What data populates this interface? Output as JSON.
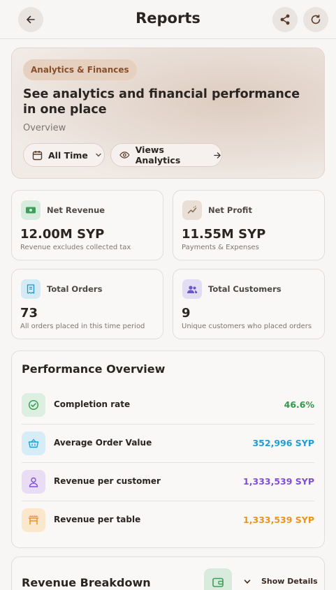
{
  "header": {
    "title": "Reports"
  },
  "hero": {
    "chip": "Analytics & Finances",
    "heading": "See analytics and financial performance in one place",
    "subtitle": "Overview",
    "filter_label": "All Time",
    "analytics_label": "Views Analytics"
  },
  "stats": [
    {
      "label": "Net Revenue",
      "value": "12.00M SYP",
      "note": "Revenue excludes collected tax",
      "icon": "banknote-icon",
      "color": "#3e9e5a"
    },
    {
      "label": "Net Profit",
      "value": "11.55M SYP",
      "note": "Payments & Expenses",
      "icon": "trend-icon",
      "color": "#8a6a4f"
    },
    {
      "label": "Total Orders",
      "value": "73",
      "note": "All orders placed in this time period",
      "icon": "receipt-icon",
      "color": "#2a93c2"
    },
    {
      "label": "Total Customers",
      "value": "9",
      "note": "Unique customers who placed orders",
      "icon": "users-icon",
      "color": "#6a55c9"
    }
  ],
  "performance": {
    "title": "Performance Overview",
    "rows": [
      {
        "label": "Completion rate",
        "value": "46.6%",
        "icon": "check-circle-icon",
        "color": "#2f9a4c"
      },
      {
        "label": "Average Order Value",
        "value": "352,996 SYP",
        "icon": "basket-icon",
        "color": "#1b9fd6"
      },
      {
        "label": "Revenue per customer",
        "value": "1,333,539 SYP",
        "icon": "user-icon",
        "color": "#7f4fd6"
      },
      {
        "label": "Revenue per table",
        "value": "1,333,539 SYP",
        "icon": "table-icon",
        "color": "#e8951c"
      }
    ]
  },
  "breakdown": {
    "title": "Revenue Breakdown",
    "toggle_label": "Show Details",
    "icon": "wallet-icon"
  }
}
